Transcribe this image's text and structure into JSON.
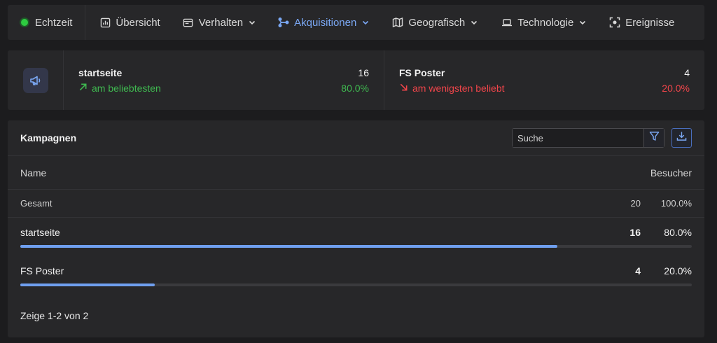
{
  "nav": {
    "items": [
      {
        "label": "Echtzeit",
        "icon": "live-dot",
        "dropdown": false
      },
      {
        "label": "Übersicht",
        "icon": "bar-chart-icon",
        "dropdown": false
      },
      {
        "label": "Verhalten",
        "icon": "browser-window-icon",
        "dropdown": true
      },
      {
        "label": "Akquisitionen",
        "icon": "share-nodes-icon",
        "dropdown": true,
        "active": true
      },
      {
        "label": "Geografisch",
        "icon": "map-icon",
        "dropdown": true
      },
      {
        "label": "Technologie",
        "icon": "laptop-icon",
        "dropdown": true
      },
      {
        "label": "Ereignisse",
        "icon": "focus-icon",
        "dropdown": false
      }
    ],
    "active_color": "#7ba8f4"
  },
  "stats": {
    "icon": "megaphone-icon",
    "top": {
      "name": "startseite",
      "count": "16",
      "trend": "am beliebtesten",
      "percent": "80.0%",
      "color": "#3fb950"
    },
    "bottom": {
      "name": "FS Poster",
      "count": "4",
      "trend": "am wenigsten beliebt",
      "percent": "20.0%",
      "color": "#f0454a"
    }
  },
  "table": {
    "title": "Kampagnen",
    "search": {
      "value": "",
      "placeholder": "Suche"
    },
    "columns": {
      "name": "Name",
      "value": "Besucher"
    },
    "total": {
      "label": "Gesamt",
      "count": "20",
      "percent": "100.0%"
    },
    "rows": [
      {
        "name": "startseite",
        "count": "16",
        "percent": "80.0%",
        "share": 0.8
      },
      {
        "name": "FS Poster",
        "count": "4",
        "percent": "20.0%",
        "share": 0.2
      }
    ],
    "footer": "Zeige 1-2 von 2",
    "bar_color": "#6f9fef"
  }
}
